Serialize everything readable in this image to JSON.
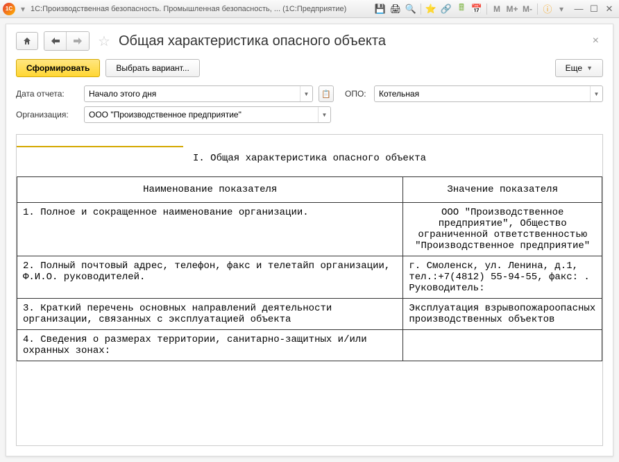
{
  "titlebar": {
    "app_icon": "1C",
    "title": "1С:Производственная безопасность. Промышленная безопасность, ... (1С:Предприятие)"
  },
  "header": {
    "page_title": "Общая характеристика опасного объекта"
  },
  "toolbar": {
    "generate_label": "Сформировать",
    "variant_label": "Выбрать вариант...",
    "more_label": "Еще"
  },
  "filters": {
    "date_label": "Дата отчета:",
    "date_value": "Начало этого дня",
    "opo_label": "ОПО:",
    "opo_value": "Котельная",
    "org_label": "Организация:",
    "org_value": "ООО \"Производственное предприятие\""
  },
  "report": {
    "section_title": "I. Общая характеристика опасного объекта",
    "col1": "Наименование показателя",
    "col2": "Значение показателя",
    "rows": [
      {
        "name": "1. Полное и сокращенное наименование организации.",
        "value": "ООО \"Производственное предприятие\", Общество ограниченной ответственностью \"Производственное предприятие\""
      },
      {
        "name": "2. Полный почтовый адрес, телефон, факс и телетайп организации, Ф.И.О. руководителей.",
        "value": "г. Смоленск, ул. Ленина, д.1, тел.:+7(4812) 55-94-55, факс: . Руководитель:"
      },
      {
        "name": "3. Краткий перечень основных направлений деятельности организации, связанных с эксплуатацией объекта",
        "value": "Эксплуатация взрывопожароопасных производственных объектов"
      },
      {
        "name": "4. Сведения о размерах территории, санитарно-защитных и/или охранных зонах:",
        "value": ""
      }
    ]
  },
  "tool_labels": {
    "m": "M",
    "mplus": "M+",
    "mminus": "M-"
  }
}
